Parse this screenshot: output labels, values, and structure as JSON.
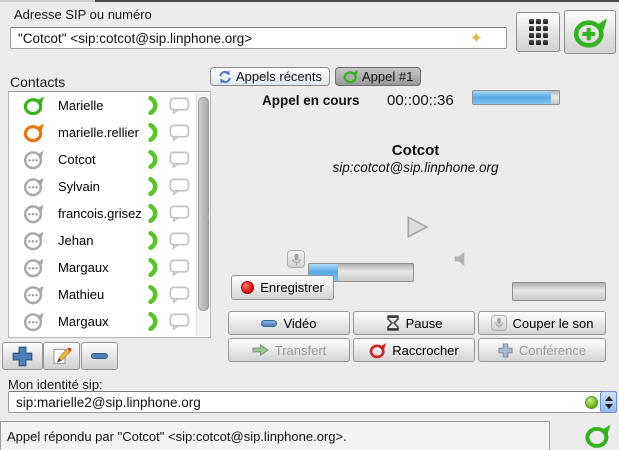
{
  "header": {
    "address_label": "Adresse SIP ou numéro",
    "address_value": "\"Cotcot\" <sip:cotcot@sip.linphone.org>"
  },
  "contacts": {
    "title": "Contacts",
    "items": [
      {
        "name": "Marielle",
        "presence": "online"
      },
      {
        "name": "marielle.rellier",
        "presence": "away"
      },
      {
        "name": "Cotcot",
        "presence": "unknown"
      },
      {
        "name": "Sylvain",
        "presence": "unknown"
      },
      {
        "name": "francois.grisez",
        "presence": "unknown"
      },
      {
        "name": "Jehan",
        "presence": "unknown"
      },
      {
        "name": "Margaux",
        "presence": "unknown"
      },
      {
        "name": "Mathieu",
        "presence": "unknown"
      },
      {
        "name": "Margaux",
        "presence": "unknown"
      }
    ]
  },
  "tabs": {
    "recent_calls": "Appels récents",
    "current_call": "Appel #1"
  },
  "call": {
    "status_label": "Appel en cours",
    "duration": "00::00::36",
    "quality_percent": 91,
    "callee_name": "Cotcot",
    "callee_uri": "sip:cotcot@sip.linphone.org",
    "record_label": "Enregistrer",
    "mic_level_percent": 28,
    "speaker_level_percent": 0
  },
  "call_buttons": {
    "video": "Vidéo",
    "pause": "Pause",
    "mute": "Couper le son",
    "transfer": "Transfert",
    "hangup": "Raccrocher",
    "conference": "Conférence"
  },
  "identity": {
    "label": "Mon identité sip:",
    "value": "sip:marielle2@sip.linphone.org"
  },
  "statusbar": {
    "message": "Appel répondu par \"Cotcot\" <sip:cotcot@sip.linphone.org>."
  },
  "colors": {
    "accent_green": "#35b220",
    "presence_away_orange": "#e07818",
    "hangup_red": "#cc2424",
    "level_blue": "#57a9e8",
    "contact_button_blue": "#4f81b8"
  },
  "icons": {
    "sparkle-icon": "✦",
    "dialpad-icon": "grid-of-keys",
    "add-call-icon": "linphone-ring-plus",
    "presence-online-icon": "linphone-ring-green",
    "presence-away-icon": "linphone-ring-orange",
    "presence-unknown-icon": "bubble-with-dots",
    "call-contact-icon": "green-handset",
    "chat-icon": "speech-bubble-outline",
    "recent-calls-icon": "blue-refresh-arrows",
    "play-icon": "▷",
    "microphone-icon": "mic-in-box",
    "speaker-icon": "◄",
    "record-icon": "red-dot",
    "video-icon": "blue-webcam-pill",
    "pause-icon": "hourglass",
    "transfer-icon": "green-right-arrow",
    "hangup-icon": "linphone-ring-red",
    "conference-icon": "blue-plus-cross",
    "status-led-icon": "green-dot",
    "call-answered-icon": "linphone-ring-green"
  }
}
